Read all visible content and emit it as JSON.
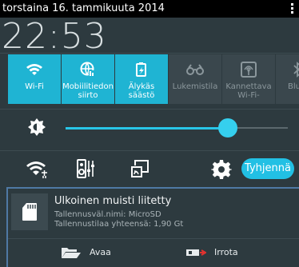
{
  "status_bar": {
    "date": "torstaina 16. tammikuuta 2014"
  },
  "clock": {
    "time": "22:53"
  },
  "quick_settings": {
    "tiles": [
      {
        "label": "Wi-Fi",
        "icon": "wifi-icon",
        "state": "on"
      },
      {
        "label": "Mobiilitiedon siirto",
        "icon": "mobile-data-icon",
        "state": "on"
      },
      {
        "label": "Älykäs säästö",
        "icon": "smart-saving-icon",
        "state": "on"
      },
      {
        "label": "Lukemistila",
        "icon": "reading-mode-icon",
        "state": "off"
      },
      {
        "label": "Kannettava Wi-Fi-",
        "icon": "portable-hotspot-icon",
        "state": "off"
      },
      {
        "label": "Bluet",
        "icon": "bluetooth-icon",
        "state": "off"
      }
    ]
  },
  "brightness": {
    "level": 0.75,
    "icon": "brightness-icon"
  },
  "toolbar": {
    "icons": [
      "wifi-settings-icon",
      "audio-settings-icon",
      "screen-cast-icon",
      "settings-gear-icon"
    ],
    "clear_label": "Tyhjennä"
  },
  "notification": {
    "icon": "sd-card-icon",
    "title": "Ulkoinen muisti liitetty",
    "line1": "Tallennusväl.nimi: MicroSD",
    "line2": "Tallennustilaa yhteensä: 1,90 Gt",
    "actions": [
      {
        "label": "Avaa",
        "icon": "folder-icon"
      },
      {
        "label": "Irrota",
        "icon": "eject-sd-icon"
      }
    ]
  },
  "colors": {
    "accent": "#1fb4d3",
    "background": "#2d3a3f"
  }
}
